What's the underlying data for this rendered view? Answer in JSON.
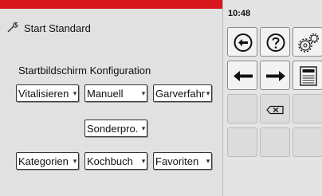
{
  "header": {
    "title": "Start Standard",
    "clock": "10:48"
  },
  "config": {
    "heading": "Startbildschirm Konfiguration",
    "dropdowns": [
      {
        "label": "Vitalisieren"
      },
      {
        "label": "Manuell"
      },
      {
        "label": "Garverfahr"
      },
      {
        "label": "Sonderpro."
      },
      {
        "label": "Kategorien"
      },
      {
        "label": "Kochbuch"
      },
      {
        "label": "Favoriten"
      }
    ]
  },
  "keypad": {
    "icons": [
      "back-circle-icon",
      "help-icon",
      "settings-gears-icon",
      "arrow-left-icon",
      "arrow-right-icon",
      "keyboard-icon",
      "backspace-icon"
    ]
  },
  "colors": {
    "accent_red": "#d6181c",
    "panel_grey": "#e1e1e1"
  }
}
